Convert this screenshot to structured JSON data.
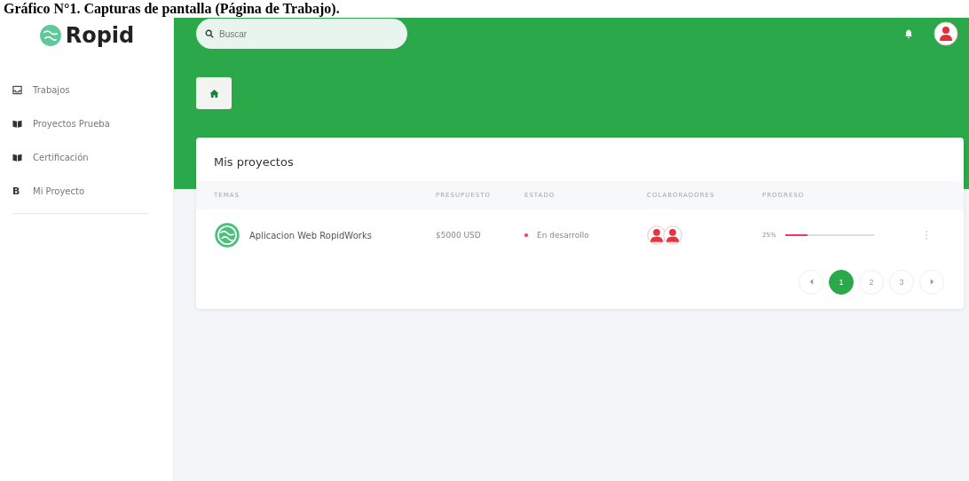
{
  "caption": "Gráfico N°1. Capturas de pantalla (Página de Trabajo).",
  "brand": "Ropid",
  "sidebar": {
    "items": [
      {
        "label": "Trabajos",
        "kind": "inbox",
        "selected": false
      },
      {
        "label": "Proyectos Prueba",
        "kind": "book",
        "selected": false
      },
      {
        "label": "Certificación",
        "kind": "book",
        "selected": false
      },
      {
        "label": "Mi Proyecto",
        "kind": "letter",
        "icon": "B",
        "selected": false
      }
    ]
  },
  "search": {
    "placeholder": "Buscar"
  },
  "card": {
    "title": "Mis proyectos",
    "columns": [
      "TEMAS",
      "PRESUPUESTO",
      "ESTADO",
      "COLABORADORES",
      "PROGRESO"
    ],
    "rows": [
      {
        "name": "Aplicacion Web RopidWorks",
        "budget": "$5000 USD",
        "status": "En desarrollo",
        "color": "#f5365c",
        "collaborators": [
          {
            "kind": "avatar"
          },
          {
            "kind": "avatar"
          }
        ],
        "progress_text": "25%",
        "level": 0.25
      }
    ],
    "pagination": [
      {
        "kind": "prev",
        "selected": false
      },
      {
        "label": "1",
        "kind": "page",
        "selected": true
      },
      {
        "label": "2",
        "kind": "page",
        "selected": false
      },
      {
        "label": "3",
        "kind": "page",
        "selected": false
      },
      {
        "kind": "next",
        "selected": false
      }
    ]
  }
}
